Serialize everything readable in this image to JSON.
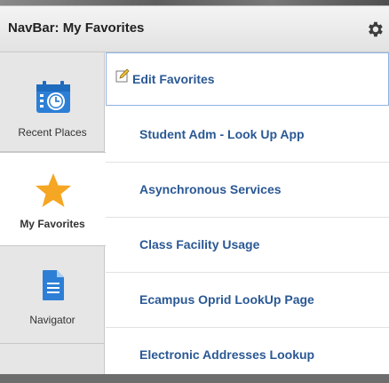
{
  "header": {
    "title": "NavBar: My Favorites"
  },
  "sidebar": {
    "items": [
      {
        "label": "Recent Places",
        "icon": "calendar-clock-icon"
      },
      {
        "label": "My Favorites",
        "icon": "star-icon"
      },
      {
        "label": "Navigator",
        "icon": "document-icon"
      }
    ]
  },
  "favorites": {
    "edit_label": "Edit Favorites",
    "items": [
      "Student Adm - Look Up App",
      "Asynchronous Services",
      "Class Facility Usage",
      "Ecampus Oprid LookUp Page",
      "Electronic Addresses Lookup"
    ]
  },
  "colors": {
    "link": "#2a5894",
    "icon_blue": "#2d7fd6",
    "star": "#f5a623",
    "selected_border": "#8fb3e6"
  }
}
